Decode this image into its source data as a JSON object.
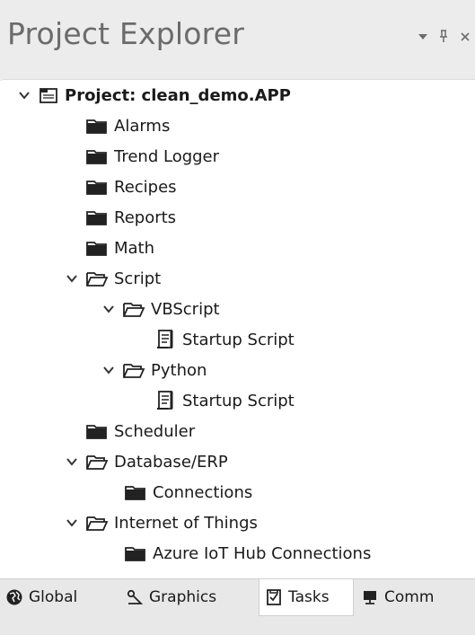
{
  "panel": {
    "title": "Project Explorer",
    "dropdown_icon": "triangle-down-icon",
    "pin_icon": "pin-icon",
    "close_icon": "close-icon"
  },
  "tree": {
    "root": "Project: clean_demo.APP",
    "alarms": "Alarms",
    "trend_logger": "Trend Logger",
    "recipes": "Recipes",
    "reports": "Reports",
    "math": "Math",
    "script": "Script",
    "vbscript": "VBScript",
    "vbscript_startup": "Startup Script",
    "python": "Python",
    "python_startup": "Startup Script",
    "scheduler": "Scheduler",
    "database_erp": "Database/ERP",
    "connections": "Connections",
    "iot": "Internet of Things",
    "azure": "Azure IoT Hub Connections"
  },
  "tabs": {
    "global": "Global",
    "graphics": "Graphics",
    "tasks": "Tasks",
    "comm": "Comm",
    "active": "tasks"
  },
  "colors": {
    "header_bg": "#ececec",
    "title_gray": "#6b6b6b",
    "icon_dark": "#222222"
  }
}
